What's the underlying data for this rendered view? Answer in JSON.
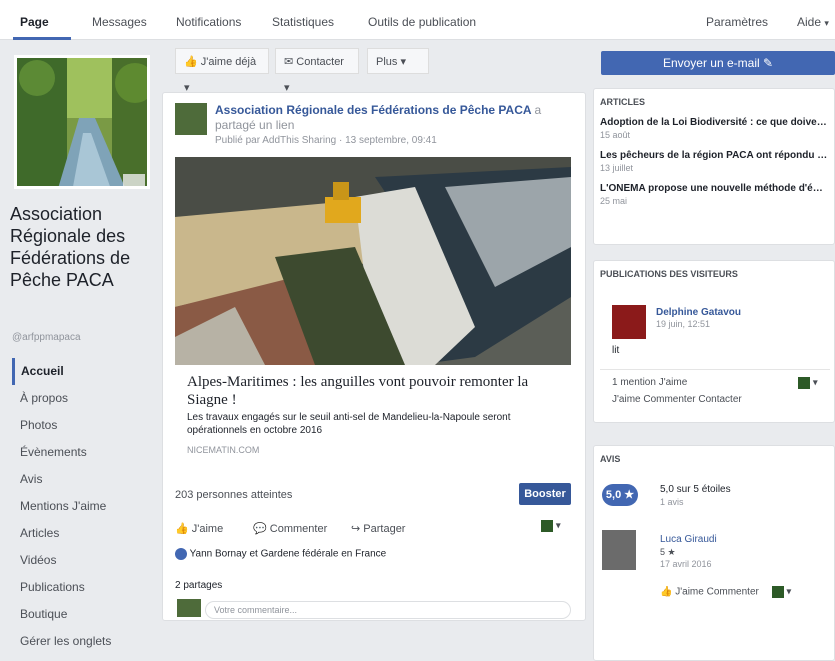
{
  "topnav": {
    "tabs": [
      "Page",
      "Messages",
      "Notifications",
      "Statistiques",
      "Outils de publication"
    ],
    "settings": "Paramètres",
    "help": "Aide"
  },
  "page": {
    "name": "Association Régionale des Fédérations de Pêche PACA",
    "handle": "@arfppmapaca"
  },
  "sidebar": {
    "items": [
      "Accueil",
      "À propos",
      "Photos",
      "Évènements",
      "Avis",
      "Mentions J'aime",
      "Articles",
      "Vidéos",
      "Publications",
      "Boutique",
      "Gérer les onglets"
    ]
  },
  "actionbar": {
    "like": "J'aime déjà",
    "contact": "Contacter",
    "more": "Plus"
  },
  "post": {
    "author": "Association Régionale des Fédérations de Pêche PACA",
    "shared": "a partagé un lien",
    "meta": "Publié par AddThis Sharing  ·  13 septembre, 09:41",
    "headline": "Alpes-Maritimes : les anguilles vont pouvoir remonter la Siagne !",
    "desc": "Les travaux engagés sur le seuil anti-sel de Mandelieu-la-Napoule seront opérationnels en octobre 2016",
    "domain": "NICEMATIN.COM",
    "reach": "203 personnes atteintes",
    "boost": "Booster",
    "like": "J'aime",
    "comment": "Commenter",
    "share": "Partager",
    "likers": "Yann Bornay et Gardene fédérale en France",
    "shares": "2 partages",
    "comment_placeholder": "Votre commentaire..."
  },
  "right": {
    "email_button": "Envoyer un e-mail",
    "articles_title": "ARTICLES",
    "articles": [
      {
        "title": "Adoption de la Loi Biodiversité : ce que doivent s...",
        "date": "15 août"
      },
      {
        "title": "Les pêcheurs de la région PACA ont répondu pré...",
        "date": "13 juillet"
      },
      {
        "title": "L'ONEMA propose une nouvelle méthode d'évalu...",
        "date": "25 mai"
      }
    ],
    "visitors_title": "PUBLICATIONS DES VISITEURS",
    "visitor": {
      "name": "Delphine Gatavou",
      "date": "19 juin, 12:51",
      "text": "lit",
      "likes": "1 mention J'aime",
      "actions": "J'aime  Commenter  Contacter"
    },
    "reviews_title": "AVIS",
    "rating": "5,0 ★",
    "rating_text": "5,0 sur 5 étoiles",
    "rating_sub": "1 avis",
    "reviewer": {
      "name": "Luca Giraudi",
      "score": "5 ★",
      "date": "17 avril 2016",
      "actions": "J'aime   Commenter"
    }
  },
  "colors": {
    "accent": "#4267b2",
    "link": "#365899"
  }
}
